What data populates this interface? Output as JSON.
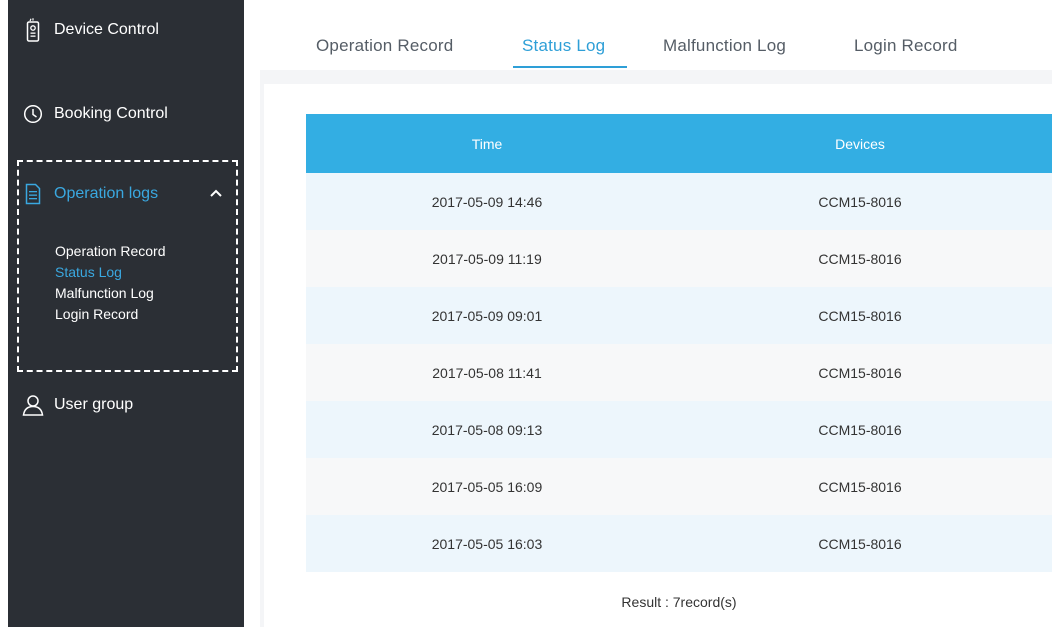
{
  "sidebar": {
    "items": [
      {
        "label": "Device Control",
        "icon": "remote-control-icon"
      },
      {
        "label": "Booking Control",
        "icon": "clock-icon"
      },
      {
        "label": "Operation logs",
        "icon": "document-icon",
        "expanded": true
      },
      {
        "label": "User group",
        "icon": "user-icon"
      }
    ],
    "submenu": [
      {
        "label": "Operation Record",
        "active": false
      },
      {
        "label": "Status Log",
        "active": true
      },
      {
        "label": "Malfunction Log",
        "active": false
      },
      {
        "label": "Login Record",
        "active": false
      }
    ]
  },
  "tabs": [
    {
      "label": "Operation Record",
      "active": false
    },
    {
      "label": "Status Log",
      "active": true
    },
    {
      "label": "Malfunction Log",
      "active": false
    },
    {
      "label": "Login Record",
      "active": false
    }
  ],
  "table": {
    "columns": [
      "Time",
      "Devices"
    ],
    "rows": [
      [
        "2017-05-09 14:46",
        "CCM15-8016"
      ],
      [
        "2017-05-09 11:19",
        "CCM15-8016"
      ],
      [
        "2017-05-09 09:01",
        "CCM15-8016"
      ],
      [
        "2017-05-08 11:41",
        "CCM15-8016"
      ],
      [
        "2017-05-08 09:13",
        "CCM15-8016"
      ],
      [
        "2017-05-05 16:09",
        "CCM15-8016"
      ],
      [
        "2017-05-05 16:03",
        "CCM15-8016"
      ]
    ]
  },
  "result": "Result : 7record(s)",
  "colors": {
    "sidebar_bg": "#2b2f35",
    "accent": "#2e9fd7",
    "header_bg": "#33aee3",
    "row_alt": "#edf6fc"
  }
}
